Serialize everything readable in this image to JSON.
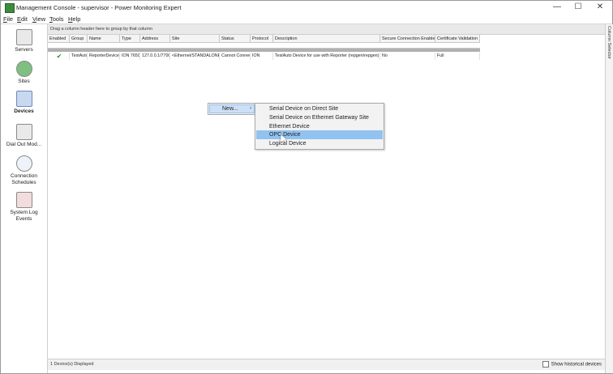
{
  "window": {
    "title": "Management Console - supervisor - Power Monitoring Expert",
    "minimize": "—",
    "maximize": "☐",
    "close": "✕"
  },
  "menubar": [
    "File",
    "Edit",
    "View",
    "Tools",
    "Help"
  ],
  "nav": [
    {
      "label": "Servers",
      "icon": "servers-icon"
    },
    {
      "label": "Sites",
      "icon": "sites-icon"
    },
    {
      "label": "Devices",
      "icon": "devices-icon",
      "active": true
    },
    {
      "label": "Dial Out Mod...",
      "icon": "modem-icon"
    },
    {
      "label": "Connection Schedules",
      "icon": "clock-icon"
    },
    {
      "label": "System Log Events",
      "icon": "log-icon"
    }
  ],
  "grid": {
    "group_hint": "Drag a column header here to group by that column",
    "columns": [
      "Enabled",
      "Group",
      "Name",
      "Type",
      "Address",
      "Site",
      "Status",
      "Protocol",
      "Description",
      "Secure Connection Enabled",
      "Certificate Validation"
    ],
    "rows": [
      [
        "✔",
        "TestAuto",
        "ReporterDevice1",
        "ION 7650",
        "127.0.0.1/7700",
        "<Ethernet/STANDALONE>",
        "Cannot Connect",
        "ION",
        "TestAuto Device for use with Reporter (repgen/repgen)",
        "No",
        "Full"
      ]
    ]
  },
  "right_panel": {
    "label": "Column Selector"
  },
  "status": {
    "count": "1 Device(s) Displayed",
    "show_historical": "Show historical devices"
  },
  "context_menu": {
    "new_label": "New...",
    "arrow": "›",
    "items": [
      "Serial Device on Direct Site",
      "Serial Device on Ethernet Gateway Site",
      "Ethernet Device",
      "OPC Device",
      "Logical Device"
    ],
    "highlighted": "OPC Device"
  },
  "colors": {
    "accent": "#91c2f0",
    "check": "#2c8a2c"
  }
}
